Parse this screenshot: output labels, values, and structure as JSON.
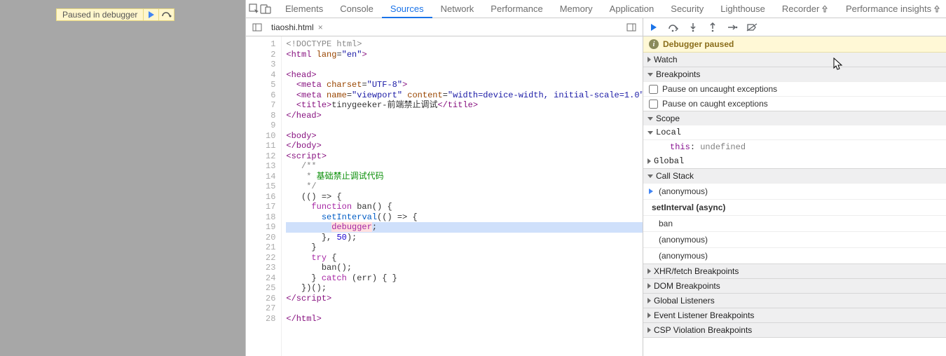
{
  "paused_badge": {
    "label": "Paused in debugger"
  },
  "tabs": {
    "items": [
      "Elements",
      "Console",
      "Sources",
      "Network",
      "Performance",
      "Memory",
      "Application",
      "Security",
      "Lighthouse",
      "Recorder",
      "Performance insights"
    ],
    "active_index": 2,
    "experimental_suffix_indices": [
      9,
      10
    ]
  },
  "editor": {
    "file_tab": "tiaoshi.html",
    "highlight_line": 19,
    "code": {
      "l1": {
        "doc": "<!DOCTYPE html>"
      },
      "l2": {
        "open": "<html ",
        "attr": "lang",
        "eq": "=",
        "val": "\"en\"",
        "close": ">"
      },
      "l3": "",
      "l4": {
        "tag": "<head>"
      },
      "l5": {
        "indent": "  ",
        "open": "<meta ",
        "attr": "charset",
        "eq": "=",
        "val": "\"UTF-8\"",
        "close": ">"
      },
      "l6": {
        "indent": "  ",
        "open": "<meta ",
        "attr1": "name",
        "eq": "=",
        "val1": "\"viewport\"",
        "sp": " ",
        "attr2": "content",
        "val2": "\"width=device-width, initial-scale=1.0\"",
        "close": ">"
      },
      "l7": {
        "indent": "  ",
        "open": "<title>",
        "text": "tinygeeker-前端禁止调试",
        "close": "</title>"
      },
      "l8": {
        "tag": "</head>"
      },
      "l9": "",
      "l10": {
        "tag": "<body>"
      },
      "l11": {
        "tag": "</body>"
      },
      "l12": {
        "tag": "<script>"
      },
      "l13": {
        "indent": "   ",
        "com": "/**"
      },
      "l14": {
        "indent": "    ",
        "star": "* ",
        "txt": "基础禁止调试代码"
      },
      "l15": {
        "indent": "    ",
        "com": "*/"
      },
      "l16": {
        "indent": "   ",
        "txt": "(() => {"
      },
      "l17": {
        "indent": "     ",
        "kw": "function",
        "rest": " ban() {"
      },
      "l18": {
        "indent": "       ",
        "fn": "setInterval",
        "rest": "(() => {"
      },
      "l19": {
        "indent": "         ",
        "dbg": "debugger",
        "rest": ";"
      },
      "l20": {
        "indent": "       ",
        "txt": "}, ",
        "num": "50",
        "rest": ");"
      },
      "l21": {
        "indent": "     ",
        "txt": "}"
      },
      "l22": {
        "indent": "     ",
        "kw": "try",
        "rest": " {"
      },
      "l23": {
        "indent": "       ",
        "txt": "ban();"
      },
      "l24": {
        "indent": "     ",
        "txt": "} ",
        "kw": "catch",
        "rest": " (err) { }"
      },
      "l25": {
        "indent": "   ",
        "txt": "})();"
      },
      "l26": {
        "tag": "</script>"
      },
      "l27": "",
      "l28": {
        "tag": "</html>"
      }
    },
    "line_count": 28
  },
  "debugger": {
    "paused_label": "Debugger paused",
    "sections": {
      "watch": "Watch",
      "breakpoints": "Breakpoints",
      "scope": "Scope",
      "callstack": "Call Stack",
      "xhr": "XHR/fetch Breakpoints",
      "dom": "DOM Breakpoints",
      "global_listeners": "Global Listeners",
      "event_listener": "Event Listener Breakpoints",
      "csp": "CSP Violation Breakpoints"
    },
    "breakpoints": {
      "uncaught": "Pause on uncaught exceptions",
      "caught": "Pause on caught exceptions"
    },
    "scope": {
      "local": "Local",
      "this_label": "this",
      "this_value": "undefined",
      "global": "Global"
    },
    "callstack": {
      "frames": [
        "(anonymous)",
        "setInterval (async)",
        "ban",
        "(anonymous)",
        "(anonymous)"
      ]
    }
  },
  "colors": {
    "accent_blue": "#1a73e8",
    "paused_bg": "#fff8d6",
    "line_hl": "#cfe0fb"
  }
}
